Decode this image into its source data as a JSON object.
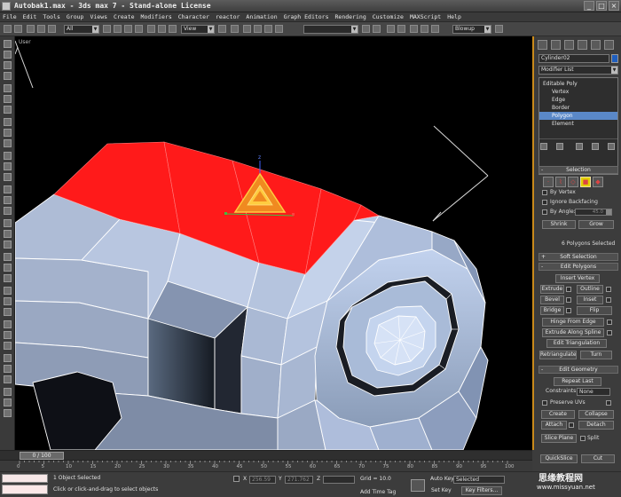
{
  "window": {
    "title": "Autobak1.max - 3ds max 7 - Stand-alone License",
    "controls": [
      "_",
      "□",
      "×"
    ]
  },
  "menu": [
    "File",
    "Edit",
    "Tools",
    "Group",
    "Views",
    "Create",
    "Modifiers",
    "Character",
    "reactor",
    "Animation",
    "Graph Editors",
    "Rendering",
    "Customize",
    "MAXScript",
    "Help"
  ],
  "toolbar": {
    "filter_value": "All",
    "coord_value": "View",
    "render_value": "Blowup"
  },
  "viewport": {
    "label": "User",
    "gizmo_axis_label": "z",
    "selected_color": "#ff1a1a",
    "mesh_color": "#b4c6e4"
  },
  "command_panel": {
    "object_name": "Cylinder02",
    "object_color": "#1f5fbf",
    "modifier_list": "Modifier List",
    "stack": {
      "root": "Editable Poly",
      "levels": [
        "Vertex",
        "Edge",
        "Border",
        "Polygon",
        "Element"
      ],
      "selected": "Polygon"
    },
    "selection": {
      "title": "Selection",
      "by_vertex": "By Vertex",
      "ignore_backfacing": "Ignore Backfacing",
      "by_angle": "By Angle:",
      "angle_value": "45.0",
      "shrink": "Shrink",
      "grow": "Grow",
      "status": "6 Polygons Selected"
    },
    "soft_selection": {
      "title": "Soft Selection"
    },
    "edit_polygons": {
      "title": "Edit Polygons",
      "insert_vertex": "Insert Vertex",
      "extrude": "Extrude",
      "outline": "Outline",
      "bevel": "Bevel",
      "inset": "Inset",
      "bridge": "Bridge",
      "flip": "Flip",
      "hinge_from_edge": "Hinge From Edge",
      "extrude_along_spline": "Extrude Along Spline",
      "edit_triangulation": "Edit Triangulation",
      "retriangulate": "Retriangulate",
      "turn": "Turn"
    },
    "edit_geometry": {
      "title": "Edit Geometry",
      "repeat_last": "Repeat Last",
      "constraints_label": "Constraints:",
      "constraints_value": "None",
      "preserve_uvs": "Preserve UVs",
      "create": "Create",
      "collapse": "Collapse",
      "attach": "Attach",
      "detach": "Detach",
      "slice_plane": "Slice Plane",
      "split": "Split",
      "quickslice": "QuickSlice",
      "cut": "Cut"
    }
  },
  "timeline": {
    "slider": "0 / 100",
    "ticks": [
      "0",
      "5",
      "10",
      "15",
      "20",
      "25",
      "30",
      "35",
      "40",
      "45",
      "50",
      "55",
      "60",
      "65",
      "70",
      "75",
      "80",
      "85",
      "90",
      "95",
      "100"
    ]
  },
  "status": {
    "objects": "1 Object Selected",
    "prompt": "Click or click-and-drag to select objects",
    "x_label": "X",
    "x_value": "256.59",
    "y_label": "Y",
    "y_value": "271.762",
    "z_label": "Z",
    "grid": "Grid = 10.0",
    "add_time_tag": "Add Time Tag",
    "auto_key": "Auto Key",
    "set_key": "Set Key",
    "key_mode": "Selected",
    "key_filters": "Key Filters..."
  },
  "watermark": {
    "cn": "思缘教程网",
    "url": "www.missyuan.net"
  }
}
